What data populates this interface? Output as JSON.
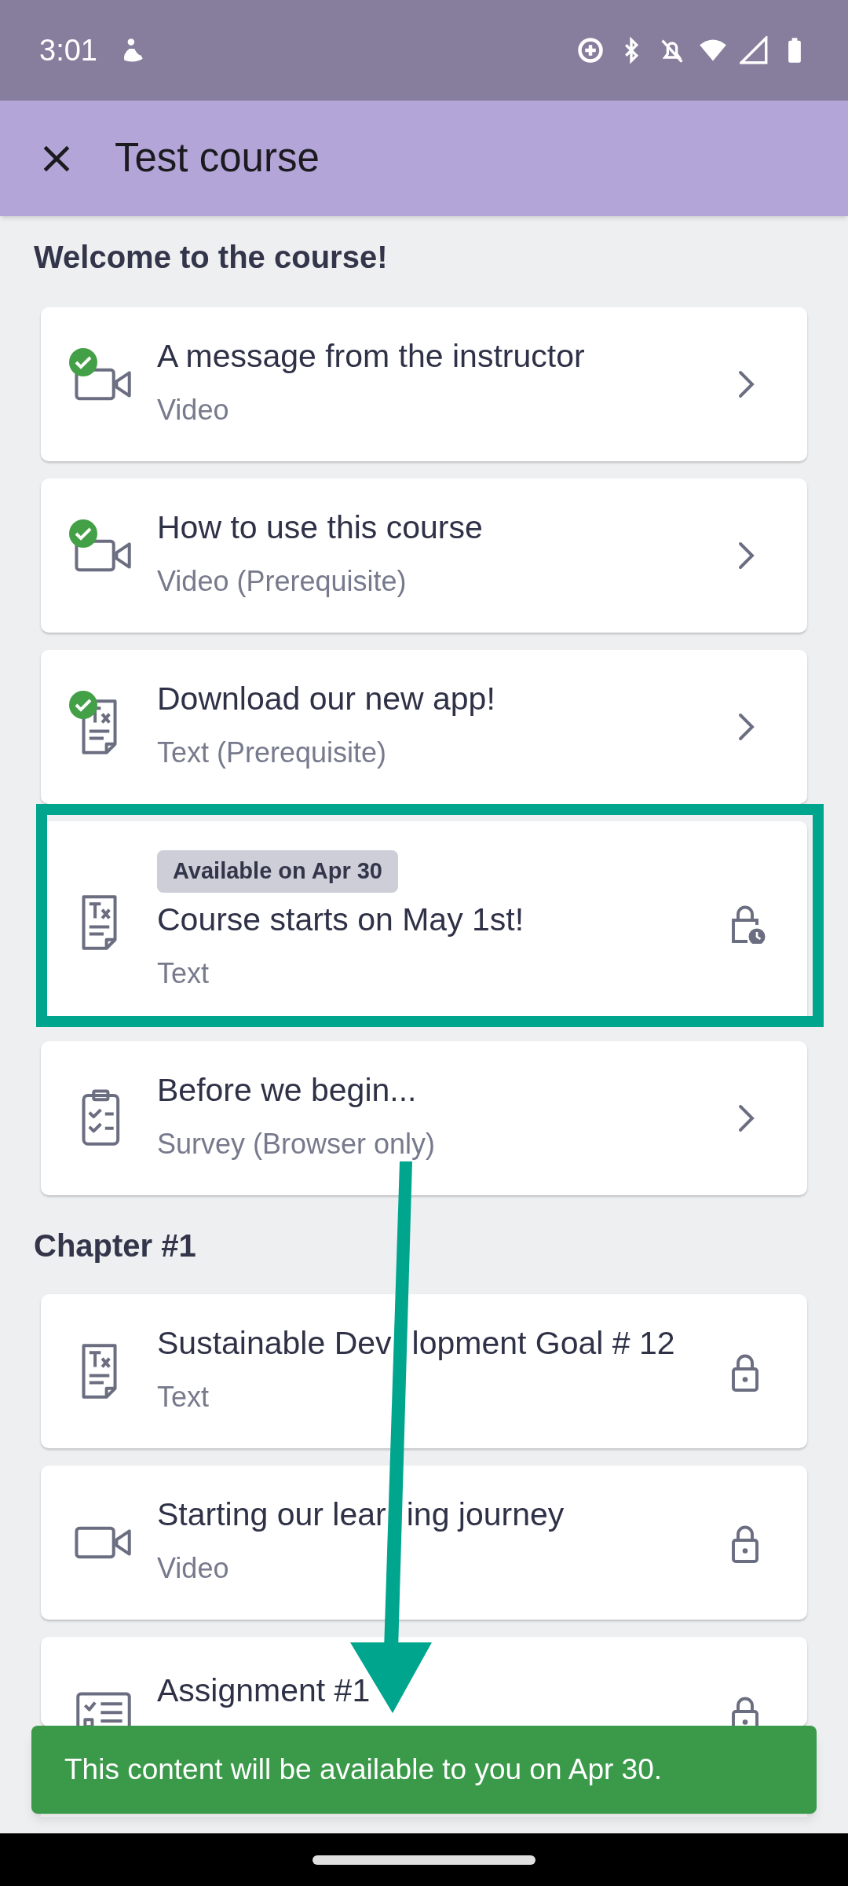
{
  "status_bar": {
    "time": "3:01"
  },
  "app_bar": {
    "title": "Test course"
  },
  "sections": [
    {
      "title": "Welcome to the course!",
      "items": [
        {
          "title_parts": [
            "A message from the instructor"
          ],
          "subtitle": "Video",
          "kind": "video",
          "completed": true,
          "locked": false
        },
        {
          "title_parts": [
            "How to use this course"
          ],
          "subtitle": "Video (Prerequisite)",
          "kind": "video",
          "completed": true,
          "locked": false
        },
        {
          "title_parts": [
            "Download our new app!"
          ],
          "subtitle": "Text (Prerequisite)",
          "kind": "text",
          "completed": true,
          "locked": false
        },
        {
          "title_parts": [
            "Course starts on May 1st!"
          ],
          "subtitle": "Text",
          "kind": "text",
          "completed": false,
          "locked": true,
          "scheduled": true,
          "badge": "Available on Apr 30",
          "highlighted": true
        },
        {
          "title_parts": [
            "Before we begin..."
          ],
          "subtitle": "Survey (Browser only)",
          "kind": "survey",
          "completed": false,
          "locked": false
        }
      ]
    },
    {
      "title": "Chapter #1",
      "items": [
        {
          "title_parts": [
            "Sustainable Dev",
            "lopment Goal # 12"
          ],
          "subtitle": "Text",
          "kind": "text",
          "completed": false,
          "locked": true
        },
        {
          "title_parts": [
            "Starting our lear",
            "ing journey"
          ],
          "subtitle": "Video",
          "kind": "video",
          "completed": false,
          "locked": true
        },
        {
          "title_parts": [
            "Assignment #1"
          ],
          "kind": "assignment",
          "completed": false,
          "locked": true
        }
      ]
    }
  ],
  "snackbar": {
    "message": "This content will be available to you on Apr 30."
  }
}
